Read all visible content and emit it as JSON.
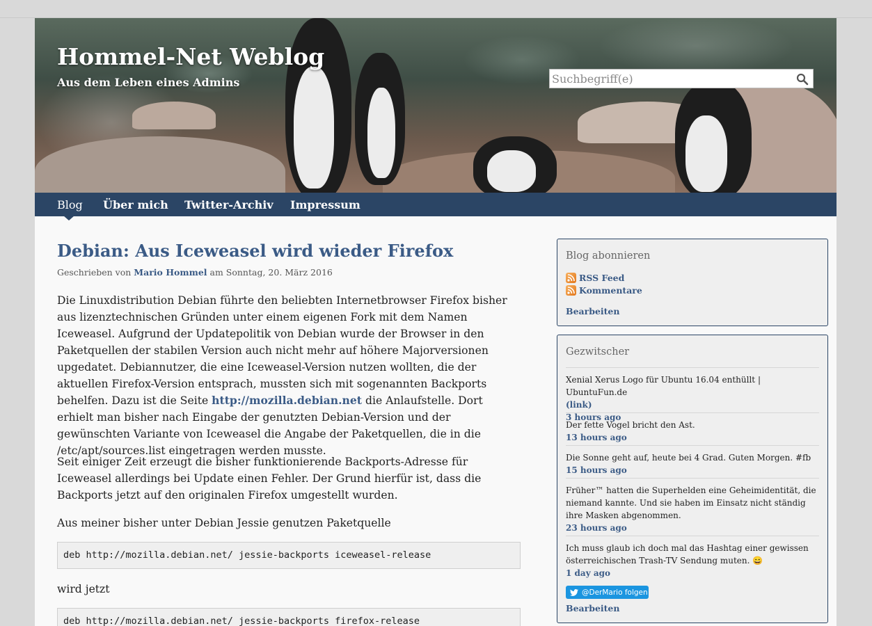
{
  "header": {
    "site_title": "Hommel-Net Weblog",
    "site_subtitle": "Aus dem Leben eines Admins",
    "search_placeholder": "Suchbegriff(e)"
  },
  "nav": {
    "items": [
      {
        "label": "Blog",
        "active": true
      },
      {
        "label": "Über mich"
      },
      {
        "label": "Twitter-Archiv"
      },
      {
        "label": "Impressum"
      }
    ]
  },
  "post": {
    "title": "Debian: Aus Iceweasel wird wieder Firefox",
    "byline_prefix": "Geschrieben von",
    "author": "Mario Hommel",
    "byline_date": "am Sonntag, 20. März 2016",
    "paragraph1_before_link": "Die Linuxdistribution Debian führte den beliebten Internetbrowser Firefox bisher aus lizenztechnischen Gründen unter einem eigenen Fork mit dem Namen Iceweasel. Auf­grund der Updatepolitik von Debian wurde der Browser in den Paketquellen der stabi­len Version auch nicht mehr auf höhere Majorversionen upgedatet. Debiannutzer, die eine Iceweasel-Version nutzen wollten, die der aktuellen Firefox-Version entsprach, mussten sich mit sogenannten Backports behelfen. Dazu ist die Seite ",
    "paragraph1_link": "http://mozilla.de­bian.net",
    "paragraph1_after_link": " die Anlaufstelle. Dort erhielt man bisher nach Eingabe der genutzten Debian-Version und der gewünschten Variante von Iceweasel die Angabe der Paketquellen, die in die /etc/apt/sources.list eingetragen werden musste.",
    "paragraph2": "Seit einiger Zeit erzeugt die bisher funktionierende Backports-Adresse für Iceweasel allerdings bei Update einen Fehler. Der Grund hierfür ist, dass die Backports jetzt auf den originalen Firefox umgestellt wurden.",
    "paragraph3": "Aus meiner bisher unter Debian Jessie genutzen Paketquelle",
    "code1": "deb http://mozilla.debian.net/ jessie-backports iceweasel-release",
    "paragraph4": "wird jetzt",
    "code2": "deb http://mozilla.debian.net/ jessie-backports firefox-release"
  },
  "sidebar": {
    "subscribe": {
      "title": "Blog abonnieren",
      "feeds": [
        "RSS Feed",
        "Kommentare"
      ],
      "edit": "Bearbeiten"
    },
    "twitter": {
      "title": "Gezwitscher",
      "tweets": [
        {
          "text": "Xenial Xerus Logo für Ubuntu 16.04 enthüllt | UbuntuFun.de",
          "link": "(link)",
          "time": "3 hours ago"
        },
        {
          "text": "Der fette Vogel bricht den Ast.",
          "time": "13 hours ago"
        },
        {
          "text": "Die Sonne geht auf, heute bei 4 Grad. Guten Morgen. #fb",
          "time": "15 hours ago"
        },
        {
          "text": "Früher™ hatten die Superhelden eine Geheimidentität, die niemand kannte. Und sie haben im Einsatz nicht ständig ihre Masken abgenommen.",
          "time": "23 hours ago"
        },
        {
          "text": "Ich muss glaub ich doch mal das Hashtag einer gewissen österreichischen Trash-TV Sendung muten. 😄",
          "time": "1 day ago"
        }
      ],
      "follow": "@DerMario folgen",
      "edit": "Bearbeiten"
    }
  },
  "colors": {
    "nav_bg": "#2b4565",
    "link": "#3b5b86",
    "twitter_blue": "#1b95e0"
  }
}
